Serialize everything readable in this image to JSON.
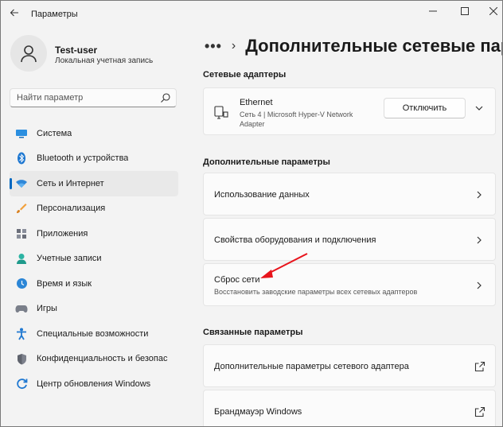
{
  "window": {
    "title": "Параметры"
  },
  "profile": {
    "name": "Test-user",
    "subtitle": "Локальная учетная запись"
  },
  "search": {
    "placeholder": "Найти параметр"
  },
  "sidebar": {
    "items": [
      {
        "label": "Система",
        "icon": "system-icon",
        "active": false
      },
      {
        "label": "Bluetooth и устройства",
        "icon": "bluetooth-icon",
        "active": false
      },
      {
        "label": "Сеть и Интернет",
        "icon": "network-icon",
        "active": true
      },
      {
        "label": "Персонализация",
        "icon": "brush-icon",
        "active": false
      },
      {
        "label": "Приложения",
        "icon": "apps-icon",
        "active": false
      },
      {
        "label": "Учетные записи",
        "icon": "accounts-icon",
        "active": false
      },
      {
        "label": "Время и язык",
        "icon": "time-language-icon",
        "active": false
      },
      {
        "label": "Игры",
        "icon": "gaming-icon",
        "active": false
      },
      {
        "label": "Специальные возможности",
        "icon": "accessibility-icon",
        "active": false
      },
      {
        "label": "Конфиденциальность и безопас",
        "icon": "privacy-shield-icon",
        "active": false
      },
      {
        "label": "Центр обновления Windows",
        "icon": "windows-update-icon",
        "active": false
      }
    ]
  },
  "breadcrumb": {
    "dots": "•••",
    "separator": "›",
    "title": "Дополнительные сетевые пара"
  },
  "sections": {
    "adapters": "Сетевые адаптеры",
    "additional": "Дополнительные параметры",
    "related": "Связанные параметры"
  },
  "adapter": {
    "name": "Ethernet",
    "description": "Сеть 4 | Microsoft Hyper-V Network Adapter",
    "button_label": "Отключить"
  },
  "additional_items": [
    {
      "label": "Использование данных"
    },
    {
      "label": "Свойства оборудования и подключения"
    },
    {
      "label": "Сброс сети",
      "sublabel": "Восстановить заводские параметры всех сетевых адаптеров"
    }
  ],
  "related_items": [
    {
      "label": "Дополнительные параметры сетевого адаптера"
    },
    {
      "label": "Брандмауэр Windows"
    }
  ],
  "colors": {
    "accent": "#0067c0",
    "annotation_arrow": "#e8141c",
    "background": "#f3f3f3",
    "card": "#fbfbfb"
  }
}
